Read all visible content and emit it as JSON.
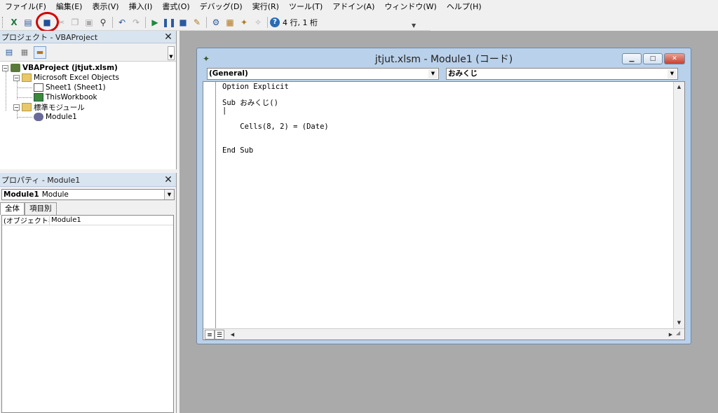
{
  "menu": [
    "ファイル(F)",
    "編集(E)",
    "表示(V)",
    "挿入(I)",
    "書式(O)",
    "デバッグ(D)",
    "実行(R)",
    "ツール(T)",
    "アドイン(A)",
    "ウィンドウ(W)",
    "ヘルプ(H)"
  ],
  "toolbar": {
    "cursor_position": "4 行, 1 桁",
    "icons": [
      "excel-view-icon",
      "insert-userform-icon",
      "save-icon",
      "cut-icon",
      "copy-icon",
      "paste-icon",
      "find-icon",
      "undo-icon",
      "redo-icon",
      "run-icon",
      "break-icon",
      "reset-icon",
      "design-mode-icon",
      "project-explorer-icon",
      "properties-window-icon",
      "object-browser-icon",
      "toolbox-icon",
      "help-icon"
    ],
    "highlight_color": "#d40000"
  },
  "project": {
    "title": "プロジェクト - VBAProject",
    "tree": {
      "root": "VBAProject (jtjut.xlsm)",
      "excel_objects": "Microsoft Excel Objects",
      "sheet1": "Sheet1 (Sheet1)",
      "workbook": "ThisWorkbook",
      "modules_folder": "標準モジュール",
      "module1": "Module1"
    }
  },
  "properties": {
    "title": "プロパティ - Module1",
    "object_name": "Module1",
    "object_type": "Module",
    "tabs": [
      "全体",
      "項目別"
    ],
    "rows": [
      {
        "name": "(オブジェクト名)",
        "value": "Module1"
      }
    ]
  },
  "code_window": {
    "title": "jtjut.xlsm - Module1 (コード)",
    "object_combo": "(General)",
    "procedure_combo": "おみくじ",
    "code": "Option Explicit\n\nSub おみくじ()\n|\n\n    Cells(8, 2) = (Date)\n\n\nEnd Sub"
  },
  "colors": {
    "mdi_background": "#aaaaaa",
    "window_frame": "#b9d1ea",
    "panel_title": "#d8e4f0"
  }
}
